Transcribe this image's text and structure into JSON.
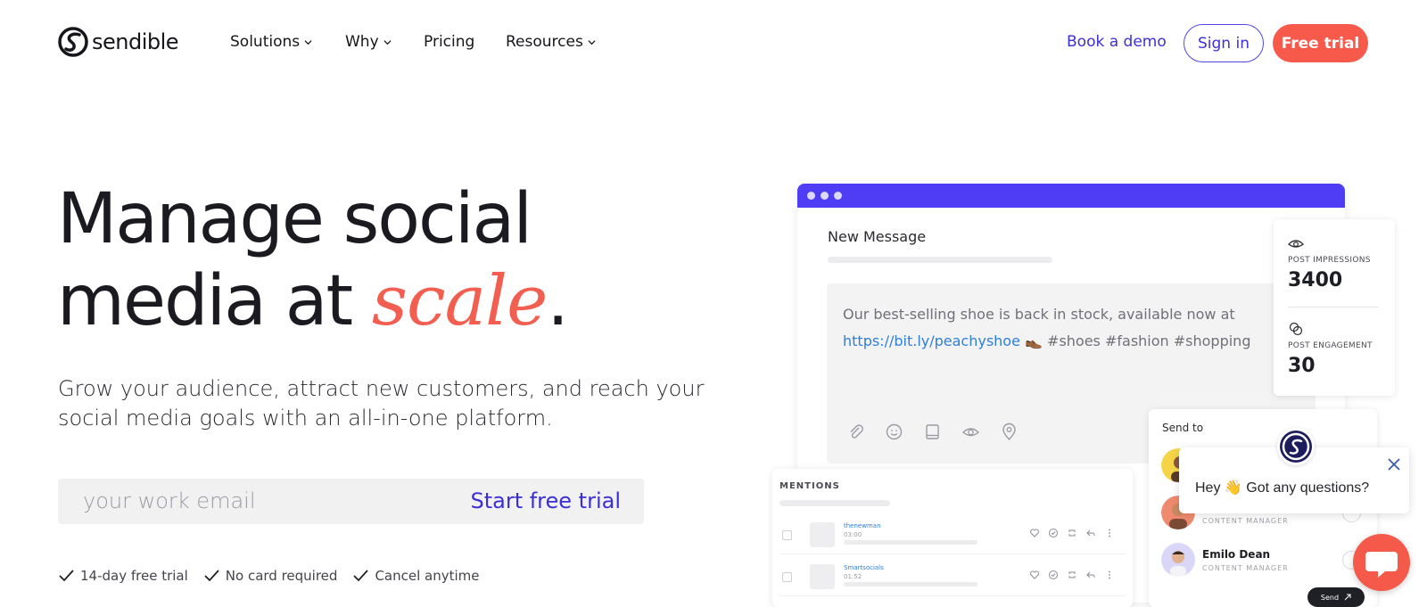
{
  "nav": {
    "logo_text": "sendible",
    "items": [
      {
        "label": "Solutions",
        "dropdown": true
      },
      {
        "label": "Why",
        "dropdown": true
      },
      {
        "label": "Pricing",
        "dropdown": false
      },
      {
        "label": "Resources",
        "dropdown": true
      }
    ],
    "book_demo": "Book a demo",
    "sign_in": "Sign in",
    "free_trial": "Free trial"
  },
  "hero": {
    "headline_line1": "Manage social",
    "headline_line2_pre": "media at ",
    "headline_accent": "scale",
    "headline_end": ".",
    "subheadline": "Grow your audience, attract new customers, and reach your social media goals with an all-in-one platform.",
    "email_placeholder": "your work email",
    "cta": "Start free trial",
    "perks": [
      "14-day free trial",
      "No card required",
      "Cancel anytime"
    ]
  },
  "mockup": {
    "message_title": "New Message",
    "compose_text_pre": "Our best-selling shoe is back in stock, available now at ",
    "compose_link": "https://bit.ly/peachyshoe",
    "compose_text_post": " 👞 #shoes #fashion #shopping",
    "stats": [
      {
        "label": "POST IMPRESSIONS",
        "value": "3400"
      },
      {
        "label": "POST ENGAGEMENT",
        "value": "30"
      }
    ],
    "mentions_title": "MENTIONS",
    "mentions": [
      {
        "handle": "thenewman",
        "time": "03:00"
      },
      {
        "handle": "Smartsocials",
        "time": "01:52"
      }
    ],
    "send_to_title": "Send to",
    "people": [
      {
        "name": "",
        "role": ""
      },
      {
        "name": "",
        "role": "CONTENT MANAGER"
      },
      {
        "name": "Emilo Dean",
        "role": "CONTENT MANAGER"
      }
    ],
    "send_label": "Send"
  },
  "chat": {
    "message": "Hey 👋 Got any questions?"
  },
  "colors": {
    "brand_purple": "#4f3cf5",
    "accent_coral": "#f25f50",
    "link_blue": "#3b2fd6"
  }
}
